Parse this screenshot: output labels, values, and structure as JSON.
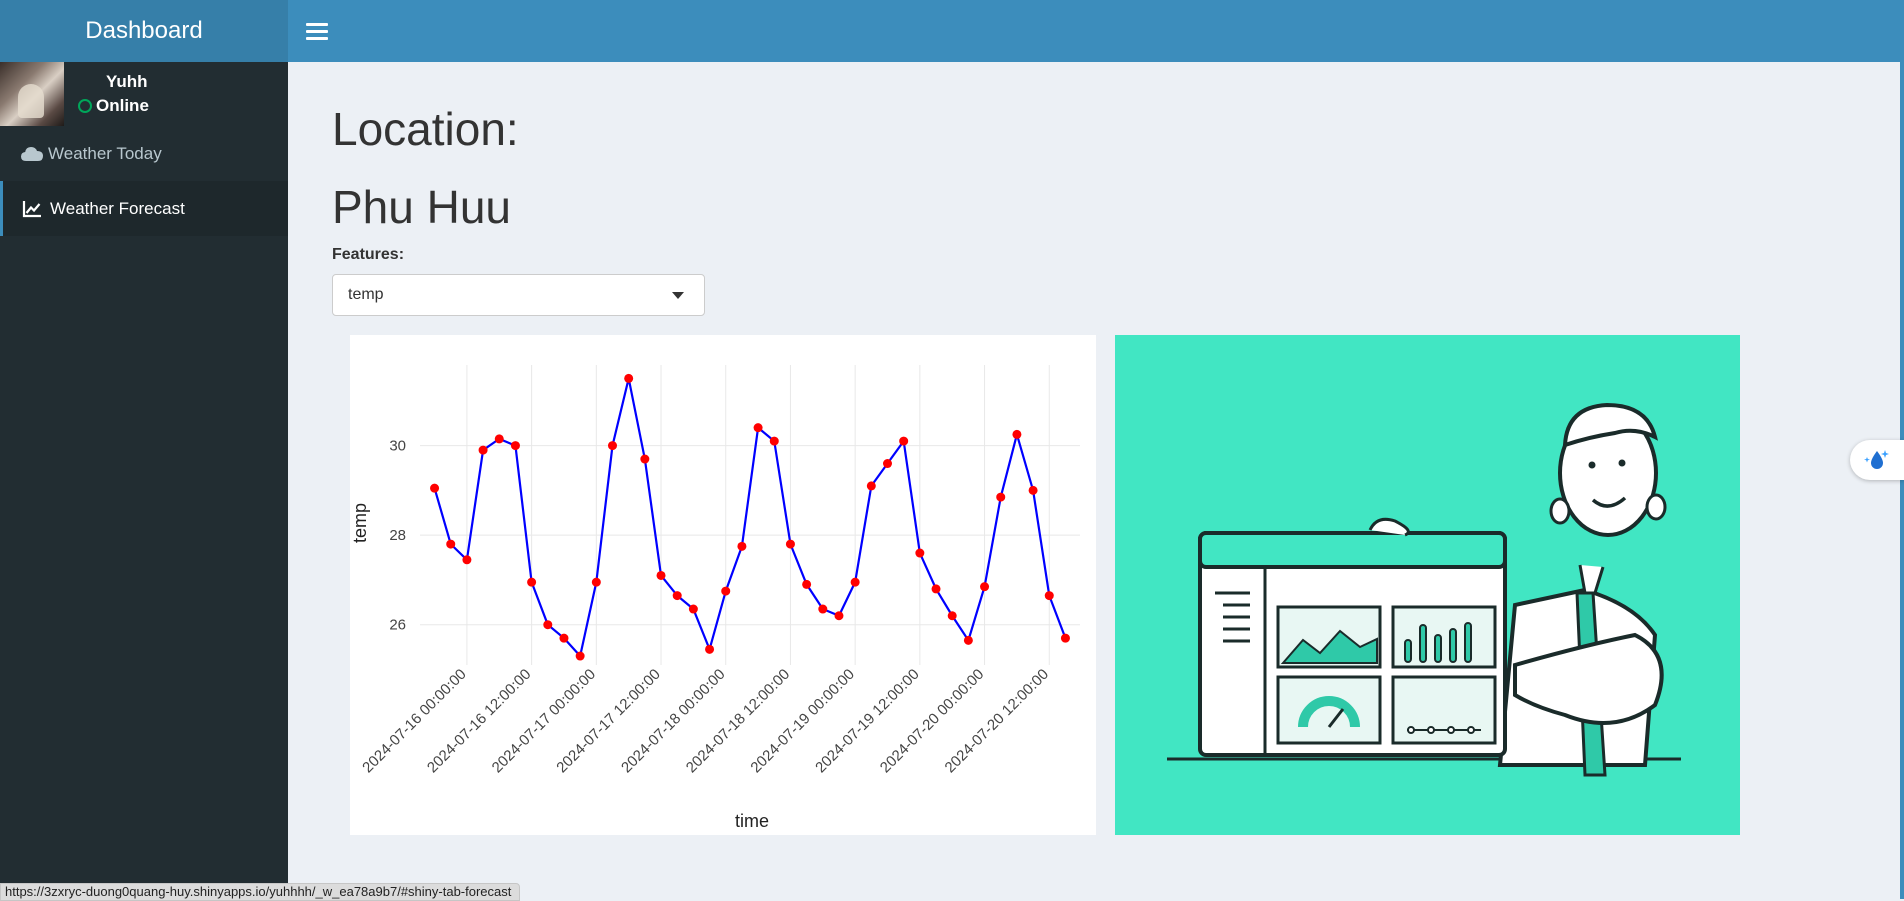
{
  "header": {
    "title": "Dashboard",
    "menu_icon": "hamburger-icon"
  },
  "sidebar": {
    "user": {
      "name": "Yuhh",
      "status": "Online"
    },
    "items": [
      {
        "label": "Weather Today",
        "icon": "cloud-icon",
        "active": false
      },
      {
        "label": "Weather Forecast",
        "icon": "line-chart-icon",
        "active": true
      }
    ]
  },
  "main": {
    "location_label": "Location:",
    "location_value": "Phu Huu",
    "features_label": "Features:",
    "features_selected": "temp"
  },
  "chart_data": {
    "type": "line",
    "title": "",
    "xlabel": "time",
    "ylabel": "temp",
    "x_start": "2024-07-15 18:00:00",
    "x_step_hours": 3,
    "x_ticks": [
      "2024-07-16 00:00:00",
      "2024-07-16 12:00:00",
      "2024-07-17 00:00:00",
      "2024-07-17 12:00:00",
      "2024-07-18 00:00:00",
      "2024-07-18 12:00:00",
      "2024-07-19 00:00:00",
      "2024-07-19 12:00:00",
      "2024-07-20 00:00:00",
      "2024-07-20 12:00:00"
    ],
    "y_ticks": [
      26,
      28,
      30
    ],
    "ylim": [
      25.1,
      31.8
    ],
    "grid": true,
    "series": [
      {
        "line_color": "#0000ff",
        "marker_color": "#ff0000",
        "values": [
          29.05,
          27.8,
          27.45,
          29.9,
          30.15,
          30.0,
          26.95,
          26.0,
          25.7,
          25.3,
          26.95,
          30.0,
          31.5,
          29.7,
          27.1,
          26.65,
          26.35,
          25.45,
          26.75,
          27.75,
          30.4,
          30.1,
          27.8,
          26.9,
          26.35,
          26.2,
          26.95,
          29.1,
          29.6,
          30.1,
          27.6,
          26.8,
          26.2,
          25.65,
          26.85,
          28.85,
          30.25,
          29.0,
          26.65,
          25.7
        ]
      }
    ]
  },
  "illustration": {
    "icon": "dashboard-illustration"
  },
  "widget": {
    "icon": "water-drop-icon"
  },
  "statusbar": {
    "url": "https://3zxryc-duong0quang-huy.shinyapps.io/yuhhhh/_w_ea78a9b7/#shiny-tab-forecast"
  }
}
